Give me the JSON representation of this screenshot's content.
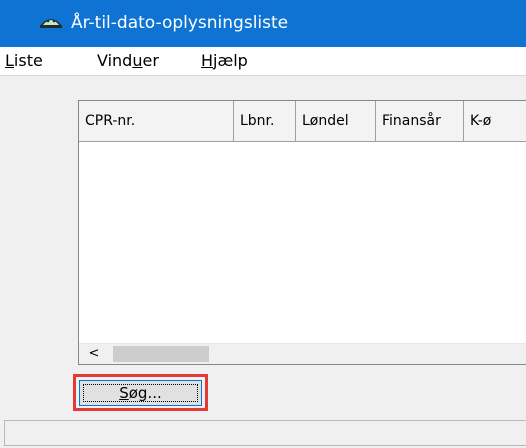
{
  "window": {
    "title": "År-til-dato-oplysningsliste",
    "icon": "app-logo-icon",
    "titlebar_color": "#0e73d2"
  },
  "menu": {
    "liste_first": "L",
    "liste_rest": "iste",
    "vinduer_pre": "Vind",
    "vinduer_u": "u",
    "vinduer_post": "er",
    "hjaelp_first": "H",
    "hjaelp_rest": "jælp"
  },
  "table": {
    "columns": [
      "CPR-nr.",
      "Lbnr.",
      "Løndel",
      "Finansår",
      "K-ø"
    ],
    "rows": []
  },
  "scrollbar": {
    "left_arrow": "<"
  },
  "search_button": {
    "label_u": "S",
    "label_rest": "øg...",
    "highlight_color": "#e43a37"
  },
  "statusbar": {
    "text": ""
  }
}
